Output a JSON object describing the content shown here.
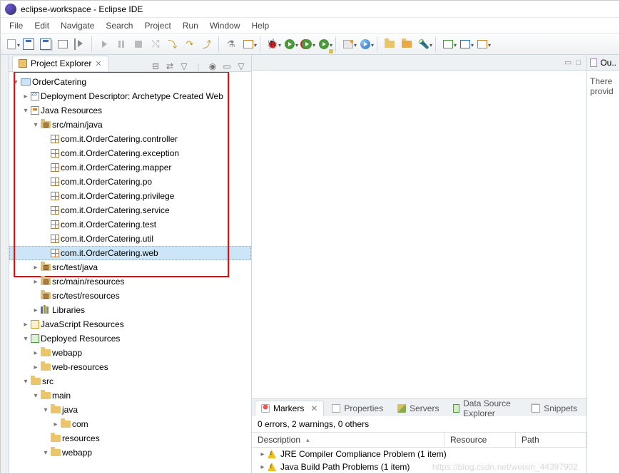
{
  "titlebar": {
    "text": "eclipse-workspace - Eclipse IDE"
  },
  "menubar": {
    "items": [
      "File",
      "Edit",
      "Navigate",
      "Search",
      "Project",
      "Run",
      "Window",
      "Help"
    ]
  },
  "explorer": {
    "title": "Project Explorer",
    "project": "OrderCatering",
    "dd": "Deployment Descriptor: Archetype Created Web",
    "jres": "Java Resources",
    "src_main_java": "src/main/java",
    "packages": [
      "com.it.OrderCatering.controller",
      "com.it.OrderCatering.exception",
      "com.it.OrderCatering.mapper",
      "com.it.OrderCatering.po",
      "com.it.OrderCatering.privilege",
      "com.it.OrderCatering.service",
      "com.it.OrderCatering.test",
      "com.it.OrderCatering.util",
      "com.it.OrderCatering.web"
    ],
    "src_test_java": "src/test/java",
    "src_main_resources": "src/main/resources",
    "src_test_resources": "src/test/resources",
    "libraries": "Libraries",
    "jsres": "JavaScript Resources",
    "depres": "Deployed Resources",
    "webapp": "webapp",
    "webresources": "web-resources",
    "src": "src",
    "main": "main",
    "java": "java",
    "com": "com",
    "resources": "resources"
  },
  "outline": {
    "title": "Ou..",
    "msg1": "There",
    "msg2": "provid"
  },
  "markers": {
    "tabs": [
      "Markers",
      "Properties",
      "Servers",
      "Data Source Explorer",
      "Snippets"
    ],
    "status": "0 errors, 2 warnings, 0 others",
    "cols": {
      "desc": "Description",
      "res": "Resource",
      "path": "Path"
    },
    "rows": [
      "JRE Compiler Compliance Problem (1 item)",
      "Java Build Path Problems (1 item)"
    ]
  },
  "watermark": "https://blog.csdn.net/weixin_44397902"
}
